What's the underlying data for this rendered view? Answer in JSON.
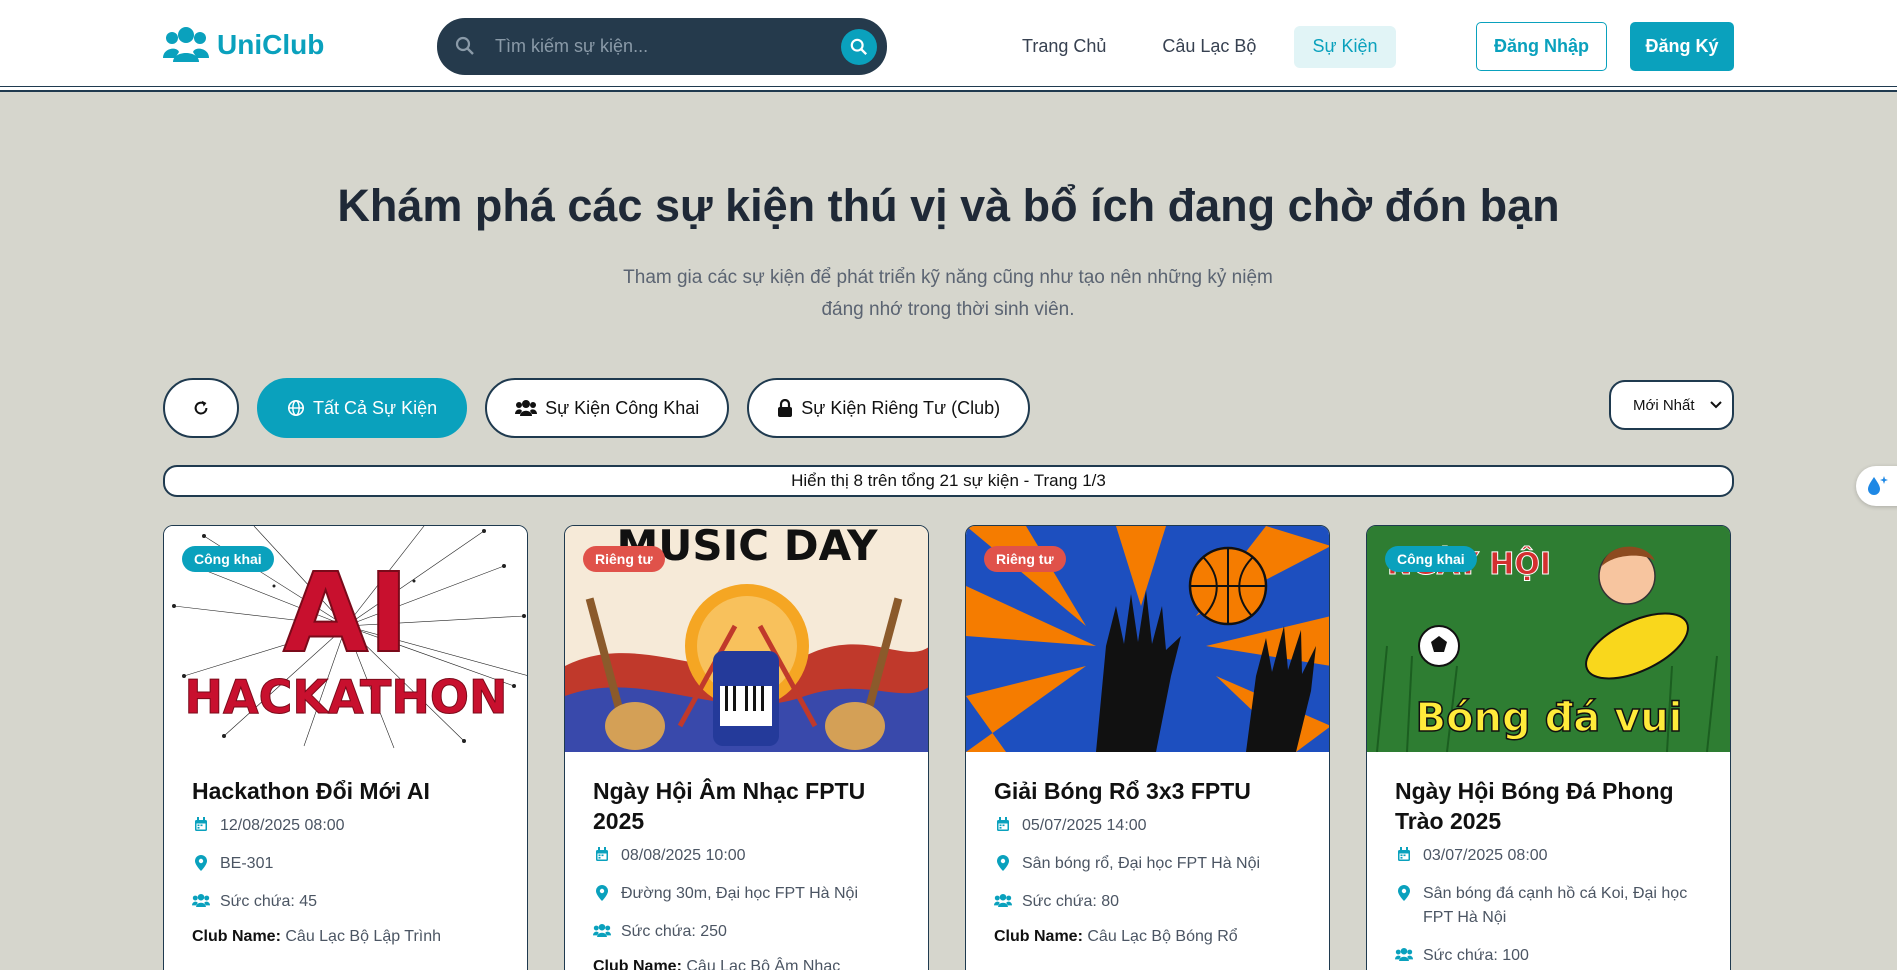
{
  "header": {
    "logo_text": "UniClub",
    "search_placeholder": "Tìm kiếm sự kiện...",
    "nav": [
      {
        "label": "Trang Chủ"
      },
      {
        "label": "Câu Lạc Bộ"
      },
      {
        "label": "Sự Kiện",
        "active": true
      }
    ],
    "login_label": "Đăng Nhập",
    "register_label": "Đăng Ký"
  },
  "hero": {
    "title": "Khám phá các sự kiện thú vị và bổ ích đang chờ đón bạn",
    "subtitle_line1": "Tham gia các sự kiện để phát triển kỹ năng cũng như tạo nên những kỷ niệm",
    "subtitle_line2": "đáng nhớ trong thời sinh viên."
  },
  "filters": {
    "all": "Tất Cả Sự Kiện",
    "public": "Sự Kiện Công Khai",
    "private": "Sự Kiện Riêng Tư (Club)",
    "sort_selected": "Mới Nhất"
  },
  "info_bar": "Hiển thị 8 trên tổng 21 sự kiện - Trang 1/3",
  "colors": {
    "accent": "#0aa1bd",
    "private_badge": "#e0524a",
    "dark": "#253a4c",
    "background": "#d6d6cd"
  },
  "events": [
    {
      "badge": "Công khai",
      "image_text_1": "AI",
      "image_text_2": "HACKATHON",
      "title": "Hackathon Đổi Mới AI",
      "datetime": "12/08/2025 08:00",
      "location": "BE-301",
      "capacity": "Sức chứa: 45",
      "club_label": "Club Name:",
      "club_name": "Câu Lạc Bộ Lập Trình"
    },
    {
      "badge": "Riêng tư",
      "image_text_1": "MUSIC DAY",
      "title": "Ngày Hội Âm Nhạc FPTU 2025",
      "datetime": "08/08/2025 10:00",
      "location": "Đường 30m, Đại học FPT Hà Nội",
      "capacity": "Sức chứa: 250",
      "club_label": "Club Name:",
      "club_name": "Câu Lạc Bộ Âm Nhạc"
    },
    {
      "badge": "Riêng tư",
      "title": "Giải Bóng Rổ 3x3 FPTU",
      "datetime": "05/07/2025 14:00",
      "location": "Sân bóng rổ, Đại học FPT Hà Nội",
      "capacity": "Sức chứa: 80",
      "club_label": "Club Name:",
      "club_name": "Câu Lạc Bộ Bóng Rổ"
    },
    {
      "badge": "Công khai",
      "image_text_1": "NGÀY HỘI",
      "image_text_2": "Bóng đá vui",
      "title": "Ngày Hội Bóng Đá Phong Trào 2025",
      "datetime": "03/07/2025 08:00",
      "location": "Sân bóng đá cạnh hồ cá Koi, Đại học FPT Hà Nội",
      "capacity": "Sức chứa: 100"
    }
  ]
}
